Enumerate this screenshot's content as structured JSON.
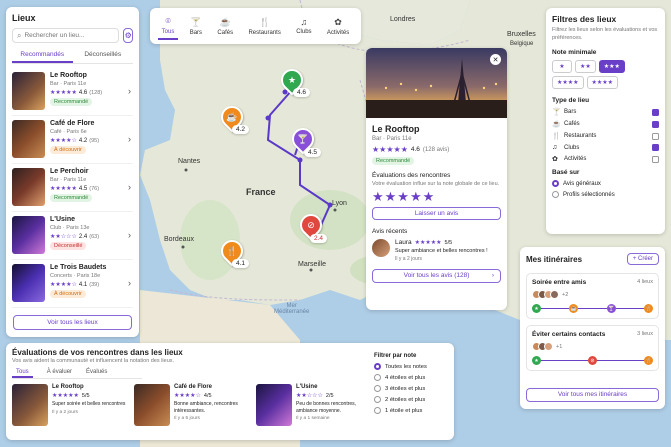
{
  "map": {
    "cities": {
      "londres": "Londres",
      "bruxelles": "Bruxelles",
      "bruxelles2": "Belgique",
      "nantes": "Nantes",
      "lyon": "Lyon",
      "bordeaux": "Bordeaux",
      "marseille": "Marseille",
      "sea": "Mer\nMéditerranée"
    },
    "country": "France",
    "pins": [
      {
        "label": "4.6",
        "color": "#2fa84f",
        "icon": "★"
      },
      {
        "label": "4.2",
        "color": "#f08a1c",
        "icon": "☕"
      },
      {
        "label": "4.5",
        "color": "#8a4fd8",
        "icon": "🍸"
      },
      {
        "label": "2.4",
        "color": "#e0483e",
        "icon": "⊘"
      },
      {
        "label": "4.1",
        "color": "#f08a1c",
        "icon": "🍴"
      }
    ]
  },
  "places": {
    "title": "Lieux",
    "search_placeholder": "Rechercher un lieu...",
    "tabs": [
      "Recommandés",
      "Déconseillés"
    ],
    "items": [
      {
        "name": "Le Rooftop",
        "meta": "Bar · Paris 11e",
        "rating": "4.6",
        "count": "(128)",
        "badge": "Recommandé",
        "badge_type": "green"
      },
      {
        "name": "Café de Flore",
        "meta": "Café · Paris 6e",
        "rating": "4.2",
        "count": "(95)",
        "badge": "À découvrir",
        "badge_type": "orange"
      },
      {
        "name": "Le Perchoir",
        "meta": "Bar · Paris 11e",
        "rating": "4.5",
        "count": "(76)",
        "badge": "Recommandé",
        "badge_type": "green"
      },
      {
        "name": "L'Usine",
        "meta": "Club · Paris 13e",
        "rating": "2.4",
        "count": "(63)",
        "badge": "Déconseillé",
        "badge_type": "red"
      },
      {
        "name": "Le Trois Baudets",
        "meta": "Concerts · Paris 18e",
        "rating": "4.1",
        "count": "(39)",
        "badge": "À découvrir",
        "badge_type": "orange"
      }
    ],
    "view_all": "Voir tous les lieux"
  },
  "categories": [
    {
      "icon": "pin-icon",
      "glyph": "⌾",
      "label": "Tous"
    },
    {
      "icon": "cocktail-icon",
      "glyph": "🍸",
      "label": "Bars"
    },
    {
      "icon": "coffee-icon",
      "glyph": "☕",
      "label": "Cafés"
    },
    {
      "icon": "fork-knife-icon",
      "glyph": "🍴",
      "label": "Restaurants"
    },
    {
      "icon": "club-icon",
      "glyph": "♫",
      "label": "Clubs"
    },
    {
      "icon": "activity-icon",
      "glyph": "✿",
      "label": "Activités"
    }
  ],
  "detail": {
    "name": "Le Rooftop",
    "meta": "Bar · Paris 11e",
    "rating": "4.6",
    "count": "(128 avis)",
    "badge": "Recommandé",
    "eval_title": "Évaluations des rencontres",
    "eval_sub": "Votre évaluation influe sur la note globale de ce lieu.",
    "leave_review": "Laisser un avis",
    "recent_title": "Avis récents",
    "review": {
      "author": "Laura",
      "score": "5/5",
      "text": "Super ambiance et belles rencontres !",
      "time": "Il y a 2 jours"
    },
    "view_all_reviews": "Voir tous les avis (128)"
  },
  "filters": {
    "title": "Filtres des lieux",
    "subtitle": "Filtrez les lieux selon les évaluations et vos préférences.",
    "min_rating_label": "Note minimale",
    "rating_options": [
      "★",
      "★★",
      "★★★",
      "★★★★",
      "★★★★"
    ],
    "type_label": "Type de lieu",
    "types": [
      {
        "label": "Bars",
        "checked": true,
        "icon": "cocktail-icon",
        "glyph": "🍸"
      },
      {
        "label": "Cafés",
        "checked": true,
        "icon": "coffee-icon",
        "glyph": "☕"
      },
      {
        "label": "Restaurants",
        "checked": false,
        "icon": "fork-knife-icon",
        "glyph": "🍴"
      },
      {
        "label": "Clubs",
        "checked": true,
        "icon": "club-icon",
        "glyph": "♫"
      },
      {
        "label": "Activités",
        "checked": false,
        "icon": "activity-icon",
        "glyph": "✿"
      }
    ],
    "based_label": "Basé sur",
    "based": [
      {
        "label": "Avis généraux",
        "selected": true
      },
      {
        "label": "Profils sélectionnés",
        "selected": false
      }
    ]
  },
  "itineraries": {
    "title": "Mes itinéraires",
    "create": "+ Créer",
    "items": [
      {
        "name": "Soirée entre amis",
        "count": "4 lieux",
        "extra": "+2"
      },
      {
        "name": "Éviter certains contacts",
        "count": "3 lieux",
        "extra": "+1"
      }
    ],
    "view_all": "Voir tous mes itinéraires"
  },
  "reviews": {
    "title": "Évaluations de vos rencontres dans les lieux",
    "subtitle": "Vos avis aident la communauté et influencent la notation des lieux.",
    "tabs": [
      "Tous",
      "À évaluer",
      "Évalués"
    ],
    "cards": [
      {
        "name": "Le Rooftop",
        "score": "5/5",
        "text": "Super soirée et belles rencontres",
        "time": "Il y a 2 jours"
      },
      {
        "name": "Café de Flore",
        "score": "4/5",
        "text": "Bonne ambiance, rencontres intéressantes.",
        "time": "Il y a 5 jours"
      },
      {
        "name": "L'Usine",
        "score": "2/5",
        "text": "Peu de bonnes rencontres, ambiance moyenne.",
        "time": "Il y a 1 semaine"
      }
    ],
    "filter_title": "Filtrer par note",
    "filter_options": [
      {
        "label": "Toutes les notes",
        "selected": true
      },
      {
        "label": "4 étoiles et plus",
        "selected": false
      },
      {
        "label": "3 étoiles et plus",
        "selected": false
      },
      {
        "label": "2 étoiles et plus",
        "selected": false
      },
      {
        "label": "1 étoile et plus",
        "selected": false
      }
    ]
  }
}
